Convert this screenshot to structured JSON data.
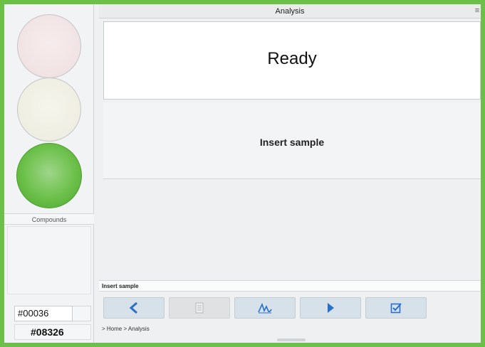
{
  "window": {
    "title": "Analysis",
    "menu_icon": "hamburger-icon"
  },
  "status": {
    "text": "Ready"
  },
  "instruction": {
    "text": "Insert sample"
  },
  "info_bar": {
    "text": "Insert sample"
  },
  "sidebar": {
    "traffic_lights": [
      {
        "name": "red",
        "active": false
      },
      {
        "name": "yellow",
        "active": false
      },
      {
        "name": "green",
        "active": true,
        "color": "#6cc04a"
      }
    ],
    "compounds_label": "Compounds",
    "codes": [
      "#00036",
      "#08326"
    ]
  },
  "toolbar": {
    "buttons": [
      {
        "icon": "chevron-left-icon",
        "enabled": true
      },
      {
        "icon": "document-icon",
        "enabled": false
      },
      {
        "icon": "signature-icon",
        "enabled": true
      },
      {
        "icon": "play-icon",
        "enabled": true
      },
      {
        "icon": "checkbox-icon",
        "enabled": true
      }
    ]
  },
  "breadcrumb": {
    "text": "> Home > Analysis"
  },
  "colors": {
    "accent": "#2a6fc9",
    "frame": "#6cc04a"
  }
}
